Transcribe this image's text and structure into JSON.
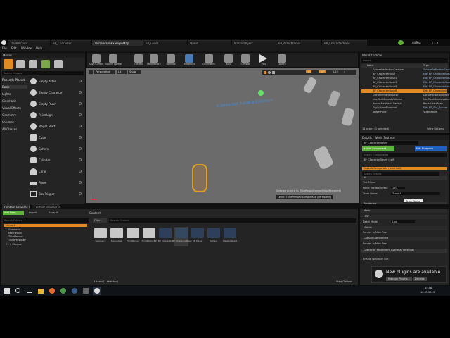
{
  "tabs": [
    {
      "label": "ThirdPersonC..."
    },
    {
      "label": "BP_Character"
    },
    {
      "label": "ThirdPersonExampleMap"
    },
    {
      "label": "BP_Level"
    },
    {
      "label": "Quest"
    },
    {
      "label": "MasterObject"
    },
    {
      "label": "BP_ActorMaster"
    },
    {
      "label": "BP_CharacterBase"
    }
  ],
  "window": {
    "project": "AllTest",
    "sys_icons": "_ ▢ ✕"
  },
  "menubar": [
    "File",
    "Edit",
    "Window",
    "Help"
  ],
  "modes": {
    "title": "Modes",
    "search_placeholder": "Search Classes"
  },
  "place_categories": [
    "Recently Placed",
    "Basic",
    "Lights",
    "Cinematic",
    "Visual Effects",
    "Geometry",
    "Volumes",
    "All Classes"
  ],
  "place_items": [
    "Empty Actor",
    "Empty Character",
    "Empty Pawn",
    "Point Light",
    "Player Start",
    "Cube",
    "Sphere",
    "Cylinder",
    "Cone",
    "Plane",
    "Box Trigger"
  ],
  "toolbar": [
    "Save Current",
    "Source Control",
    "Content",
    "Marketplace",
    "Settings",
    "Blueprints",
    "Cinematics",
    "Build",
    "Compile",
    "Play",
    "Launch"
  ],
  "viewport": {
    "perspective": "Perspective",
    "lit": "Lit",
    "show": "Show",
    "snap_value": "10",
    "snap_angle": "10°",
    "snap_scale": "0.25",
    "cam_speed": "4",
    "floating_text": "It does not have a Collision",
    "level_label": "Level: ThirdPersonExampleMap (Persistent)",
    "actor_info": "Selected Actor(s) in: ThirdPersonExampleMap (Persistent)"
  },
  "world_outliner": {
    "title": "World Outliner",
    "search_placeholder": "Search...",
    "col_label": "Label",
    "col_type": "Type",
    "rows": [
      {
        "label": "SphereReflectionCapture",
        "type": "SphereReflectionCapture"
      },
      {
        "label": "BP_CharacterBase",
        "type": "Edit BP_CharacterBase"
      },
      {
        "label": "BP_CharacterBase2",
        "type": "Edit BP_CharacterBase"
      },
      {
        "label": "BP_CharacterBase3",
        "type": "Edit BP_CharacterBase"
      },
      {
        "label": "BP_CharacterBase5",
        "type": "Edit BP_CharacterBase"
      },
      {
        "label": "BP_CharacterBase6",
        "type": "Edit BP_CharacterBase"
      },
      {
        "label": "DocumentationActor1",
        "type": "DocumentationActor"
      },
      {
        "label": "NavMeshBoundsVolume",
        "type": "NavMeshBoundsVolume"
      },
      {
        "label": "RecastNavMesh-Default",
        "type": "RecastNavMesh"
      },
      {
        "label": "SkySphereBlueprint",
        "type": "Edit BP_Sky_Sphere"
      },
      {
        "label": "TargetPoint",
        "type": "TargetPoint"
      }
    ],
    "footer": "11 actors (1 selected)",
    "view_options": "View Options"
  },
  "details": {
    "title": "Details",
    "world_settings": "World Settings",
    "selected_name": "BP_CharacterBase6",
    "search_placeholder": "Search Components",
    "add_component": "+ Add Component",
    "edit_blueprint": "Edit Blueprint",
    "self_row": "BP_CharacterBase6 (self)",
    "capsule": "CapsuleComponent (Inherited)",
    "search_details": "Search Details",
    "sections": [
      {
        "name": "AI"
      },
      {
        "name": "Rendering"
      },
      {
        "name": "Mesh"
      },
      {
        "name": "LOD"
      },
      {
        "name": "Mobile"
      },
      {
        "name": "CapsuleComponent"
      },
      {
        "name": "Character Movement (General Settings)"
      }
    ],
    "ai_rows": [
      {
        "label": "Tint Mover",
        "value": ""
      },
      {
        "label": "Force Feedback Max",
        "value": "150"
      },
      {
        "label": "Team Name",
        "value": "Team A"
      }
    ],
    "tooltip": "Team Name",
    "render_rows": [
      {
        "label": "Detail Mode",
        "value": "Low"
      },
      {
        "label": "Render In Main Pass",
        "value": ""
      },
      {
        "label": "Render In Main Pass",
        "value": ""
      },
      {
        "label": "Enable Walkable Slot",
        "value": ""
      }
    ]
  },
  "content_browser": {
    "tab1": "Content Browser 1",
    "tab2": "Content Browser 2",
    "add_new": "Add New",
    "import": "Import",
    "save_all": "Save All",
    "path": "Content",
    "search_folders": "Search Folders",
    "filters": "Filters",
    "search_content": "Search Content",
    "tree": [
      "Content",
      "Geometry",
      "Mannequin",
      "ThirdPerson",
      "ThirdPersonBP",
      "C++ Classes"
    ],
    "items": [
      "Geometry",
      "Mannequin",
      "ThirdPerson",
      "ThirdPersonBP",
      "BP_Character",
      "BP_CharacterBase",
      "BP_Player",
      "Sphere",
      "MasterObject"
    ],
    "footer": "9 items (1 selected)",
    "view_options": "View Options"
  },
  "notification": {
    "message": "New plugins are available",
    "manage": "Manage Plugins...",
    "dismiss": "Dismiss"
  },
  "taskbar": {
    "time": "15:58",
    "date": "16.05.2019"
  },
  "colors": {
    "accent": "#e08a24",
    "green": "#5fb33a",
    "blue": "#2060c0",
    "float_text": "#3b8fe8"
  }
}
